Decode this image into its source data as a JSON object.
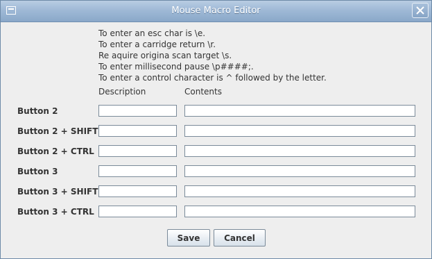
{
  "window": {
    "title": "Mouse Macro Editor",
    "app_icon": "window-icon",
    "close_icon": "close-icon"
  },
  "instructions": [
    "To enter an esc char is \\e.",
    "To enter a carridge return \\r.",
    "Re aquire origina scan target \\s.",
    "To enter millisecond pause \\p####;.",
    "To enter a control character is ^ followed by the letter."
  ],
  "columns": {
    "description": "Description",
    "contents": "Contents"
  },
  "rows": [
    {
      "label": "Button 2",
      "description": "",
      "contents": ""
    },
    {
      "label": "Button 2 + SHIFT",
      "description": "",
      "contents": ""
    },
    {
      "label": "Button 2 + CTRL",
      "description": "",
      "contents": ""
    },
    {
      "label": "Button 3",
      "description": "",
      "contents": ""
    },
    {
      "label": "Button 3 + SHIFT",
      "description": "",
      "contents": ""
    },
    {
      "label": "Button 3 + CTRL",
      "description": "",
      "contents": ""
    }
  ],
  "buttons": {
    "save": "Save",
    "cancel": "Cancel"
  },
  "colors": {
    "titlebar": "#9fb9d6",
    "background": "#eeeeee",
    "field_border": "#7a8a99"
  }
}
